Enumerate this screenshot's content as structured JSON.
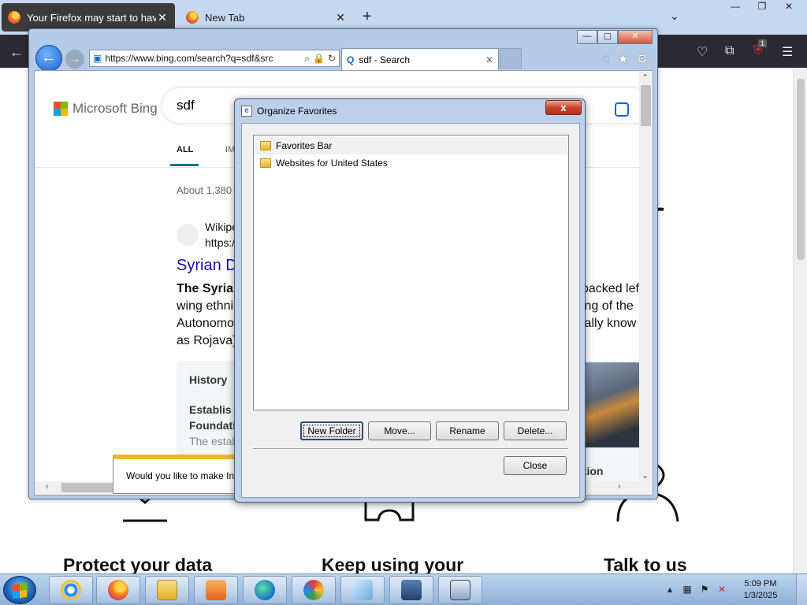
{
  "firefox": {
    "tabs": [
      {
        "label": "Your Firefox may start to have p"
      },
      {
        "label": "New Tab"
      }
    ],
    "content": {
      "features": [
        {
          "title": "Protect your data"
        },
        {
          "title": "Keep using your"
        },
        {
          "title": "Talk to us"
        }
      ]
    },
    "extension_badge": "1"
  },
  "ie": {
    "address_url": "https://www.bing.com/search?q=sdf&src",
    "tab_title": "sdf - Search",
    "bing": {
      "logo_text": "Microsoft Bing",
      "query": "sdf",
      "tab_all": "ALL",
      "tab_partial": "IM",
      "result_count": "About 1,380",
      "site_name": "Wikipe",
      "site_url": "https://",
      "result_title": "Syrian D",
      "snippet_line1_bold": "The Syria",
      "snippet_line1_right": "packed lef",
      "snippet_line2_left": "wing ethni",
      "snippet_line2_right": "ing of the",
      "snippet_line3_left": "Autonomo",
      "snippet_line3_right": "ially know",
      "snippet_line4": "as Rojava)",
      "card": {
        "history": "History",
        "established": "Establis",
        "foundation": "Foundati",
        "text": "The estal",
        "option": "ation"
      }
    },
    "infobar_text": "Would you like to make In"
  },
  "dialog": {
    "title": "Organize Favorites",
    "close_glyph": "x",
    "items": [
      {
        "label": "Favorites Bar"
      },
      {
        "label": "Websites for United States"
      }
    ],
    "buttons": {
      "new_folder": "New Folder",
      "move": "Move...",
      "rename": "Rename",
      "delete": "Delete...",
      "close": "Close"
    }
  },
  "taskbar": {
    "apps": [
      "Internet Explorer",
      "Firefox",
      "File Explorer",
      "Media Player",
      "Edge",
      "Paint",
      "Notepad",
      "VirtualBox",
      "Windows 7 x64"
    ],
    "clock_time": "5:09 PM",
    "clock_date": "1/3/2025"
  }
}
